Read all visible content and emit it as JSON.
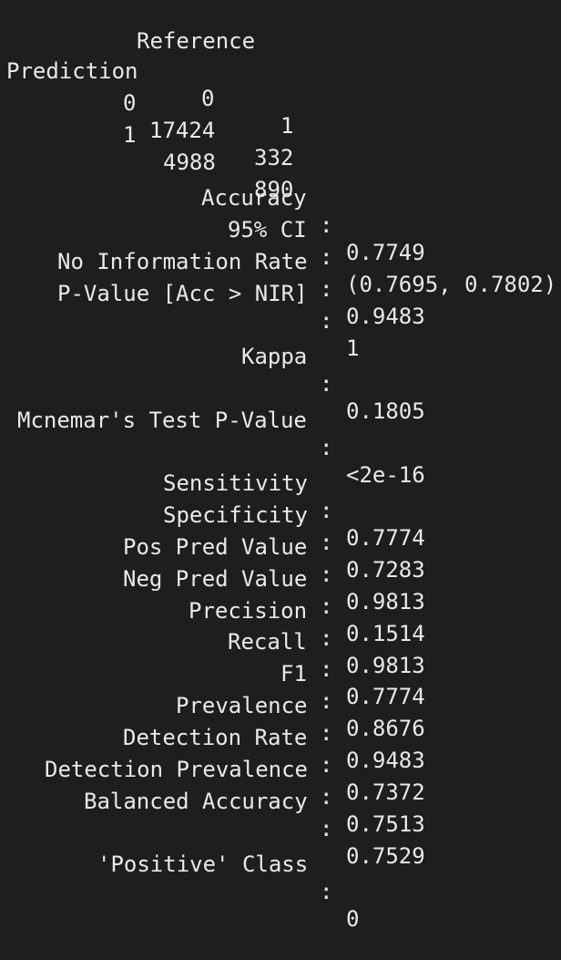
{
  "confusion_matrix": {
    "reference_label": "Reference",
    "prediction_label": "Prediction",
    "col_headers": [
      "0",
      "1"
    ],
    "rows": [
      {
        "label": "0",
        "values": [
          "17424",
          "332"
        ]
      },
      {
        "label": "1",
        "values": [
          "4988",
          "890"
        ]
      }
    ]
  },
  "stats": {
    "accuracy": {
      "label": "Accuracy",
      "value": "0.7749"
    },
    "ci": {
      "label": "95% CI",
      "value": "(0.7695, 0.7802)"
    },
    "nir": {
      "label": "No Information Rate",
      "value": "0.9483"
    },
    "pvalue": {
      "label": "P-Value [Acc > NIR]",
      "value": "1"
    },
    "kappa": {
      "label": "Kappa",
      "value": "0.1805"
    },
    "mcnemar": {
      "label": "Mcnemar's Test P-Value",
      "value": "<2e-16"
    },
    "sensitivity": {
      "label": "Sensitivity",
      "value": "0.7774"
    },
    "specificity": {
      "label": "Specificity",
      "value": "0.7283"
    },
    "ppv": {
      "label": "Pos Pred Value",
      "value": "0.9813"
    },
    "npv": {
      "label": "Neg Pred Value",
      "value": "0.1514"
    },
    "precision": {
      "label": "Precision",
      "value": "0.9813"
    },
    "recall": {
      "label": "Recall",
      "value": "0.7774"
    },
    "f1": {
      "label": "F1",
      "value": "0.8676"
    },
    "prevalence": {
      "label": "Prevalence",
      "value": "0.9483"
    },
    "detection_rate": {
      "label": "Detection Rate",
      "value": "0.7372"
    },
    "detection_prevalence": {
      "label": "Detection Prevalence",
      "value": "0.7513"
    },
    "balanced_accuracy": {
      "label": "Balanced Accuracy",
      "value": "0.7529"
    },
    "positive_class": {
      "label": "'Positive' Class",
      "value": "0"
    }
  },
  "separator": ":",
  "colors": {
    "background": "#1e1e1e",
    "text": "#e9e9e9"
  }
}
